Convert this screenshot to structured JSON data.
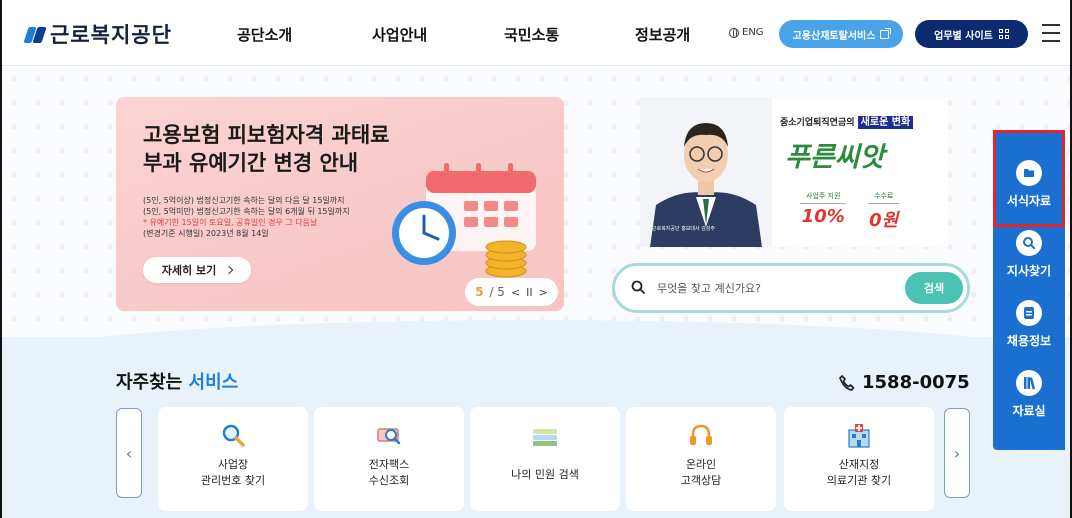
{
  "header": {
    "logo_text": "근로복지공단",
    "nav": [
      "공단소개",
      "사업안내",
      "국민소통",
      "정보공개"
    ],
    "eng_label": "ENG",
    "portal_button": "고용산재토탈서비스",
    "work_button": "업무별 사이트"
  },
  "banner": {
    "title_line1": "고용보험 피보험자격 과태료",
    "title_line2": "부과 유예기간 변경 안내",
    "body": [
      "(5인, 5억이상) 법정신고기한 속하는 달의 다음 달 15일까지",
      "(5인, 5억미만) 법정신고기한 속하는 달의 6개월 뒤 15일까지",
      "* 유예기한 15일이 토요일, 공휴일인 경우 그 다음날",
      "(변경기준 시행일) 2023년 8월 14일"
    ],
    "detail_button": "자세히 보기",
    "pager_current": "5",
    "pager_total": "/ 5"
  },
  "ad": {
    "line1_prefix": "중소기업퇴직연금의",
    "line1_highlight": "새로운 변화",
    "brand": "푸른씨앗",
    "col1_label": "사업주 지원",
    "col1_value": "10%",
    "col2_label": "수수료",
    "col2_value": "0원",
    "caption": "근로복지공단 홍보대사 김성주"
  },
  "search": {
    "placeholder": "무엇을 찾고 계신가요?",
    "button": "검색"
  },
  "services": {
    "title_prefix": "자주찾는",
    "title_highlight": "서비스",
    "phone": "1588-0075",
    "items": [
      {
        "line1": "사업장",
        "line2": "관리번호 찾기"
      },
      {
        "line1": "전자팩스",
        "line2": "수신조회"
      },
      {
        "line1": "나의 민원 검색",
        "line2": ""
      },
      {
        "line1": "온라인",
        "line2": "고객상담"
      },
      {
        "line1": "산재지정",
        "line2": "의료기관 찾기"
      }
    ]
  },
  "quick_menu": {
    "items": [
      "서식자료",
      "지사찾기",
      "채용정보",
      "자료실"
    ],
    "active": "서식자료"
  },
  "colors": {
    "brand_blue": "#1a6fd0",
    "navy": "#0b2a6f",
    "highlight_red": "#e3252b",
    "search_green": "#4cc2b2"
  }
}
